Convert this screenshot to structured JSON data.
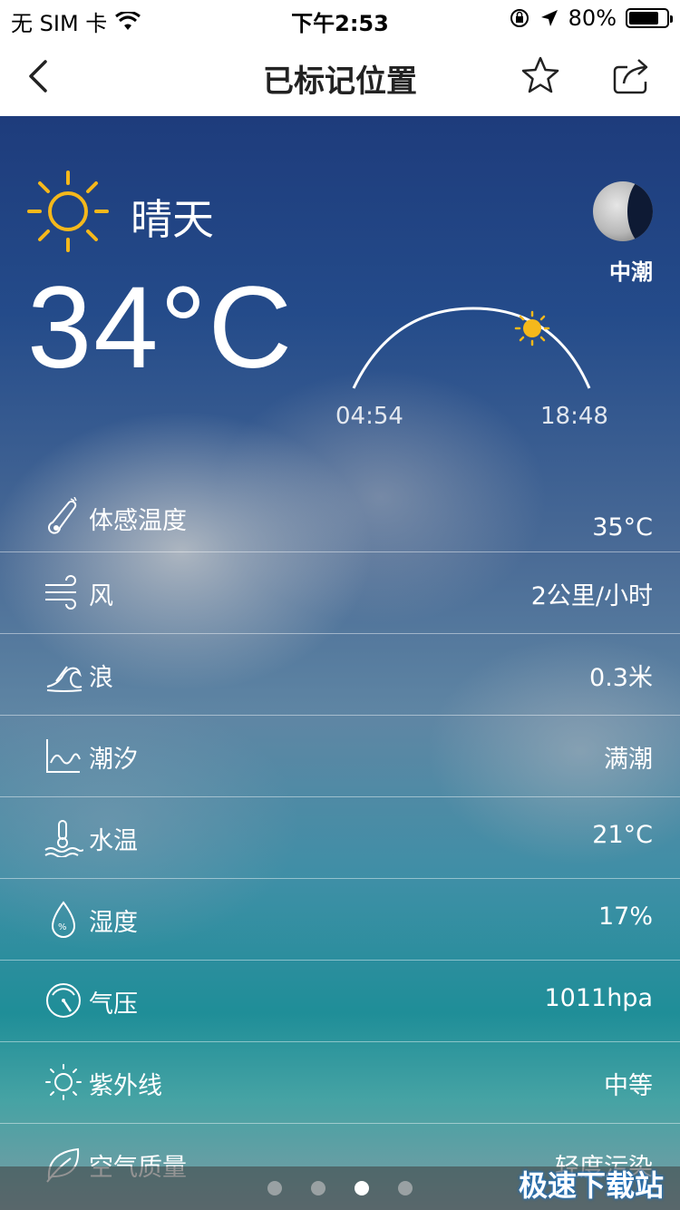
{
  "status_bar": {
    "carrier": "无 SIM 卡",
    "time": "下午2:53",
    "battery": "80%",
    "battery_level": 0.8
  },
  "nav": {
    "title": "已标记位置"
  },
  "weather": {
    "condition": "晴天",
    "temperature": "34°C",
    "tide_state": "中潮",
    "sunrise": "04:54",
    "sunset": "18:48"
  },
  "details": [
    {
      "icon": "thermometer-icon",
      "label": "体感温度",
      "value": "35°C"
    },
    {
      "icon": "wind-icon",
      "label": "风",
      "value": "2公里/小时"
    },
    {
      "icon": "wave-icon",
      "label": "浪",
      "value": "0.3米"
    },
    {
      "icon": "tide-icon",
      "label": "潮汐",
      "value": "满潮"
    },
    {
      "icon": "water-temp-icon",
      "label": "水温",
      "value": "21°C"
    },
    {
      "icon": "humidity-icon",
      "label": "湿度",
      "value": "17%"
    },
    {
      "icon": "pressure-icon",
      "label": "气压",
      "value": "1011hpa"
    },
    {
      "icon": "uv-icon",
      "label": "紫外线",
      "value": "中等"
    },
    {
      "icon": "leaf-icon",
      "label": "空气质量",
      "value": "轻度污染"
    }
  ],
  "pager": {
    "count": 4,
    "active_index": 2
  },
  "watermark": "极速下载站"
}
